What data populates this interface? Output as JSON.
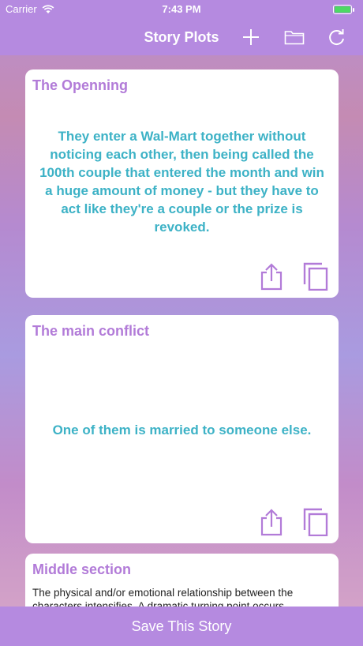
{
  "status_bar": {
    "carrier": "Carrier",
    "time": "7:43 PM"
  },
  "nav": {
    "title": "Story Plots",
    "icons": [
      "plus-icon",
      "folder-icon",
      "refresh-icon"
    ]
  },
  "cards": [
    {
      "title": "The Openning",
      "body": "They enter a Wal-Mart together without noticing each other, then being called the 100th couple that entered the month and win a huge amount of money - but they have to act like they're a couple or the prize is revoked."
    },
    {
      "title": "The main conflict",
      "body": "One of them is married to someone else."
    },
    {
      "title": "Middle section",
      "body": "The physical and/or emotional relationship between the characters intensifies. A dramatic turning point occurs."
    }
  ],
  "footer": {
    "save_label": "Save This Story"
  },
  "colors": {
    "accent": "#b58ae0",
    "title": "#b27bd8",
    "body": "#3db2c6"
  }
}
